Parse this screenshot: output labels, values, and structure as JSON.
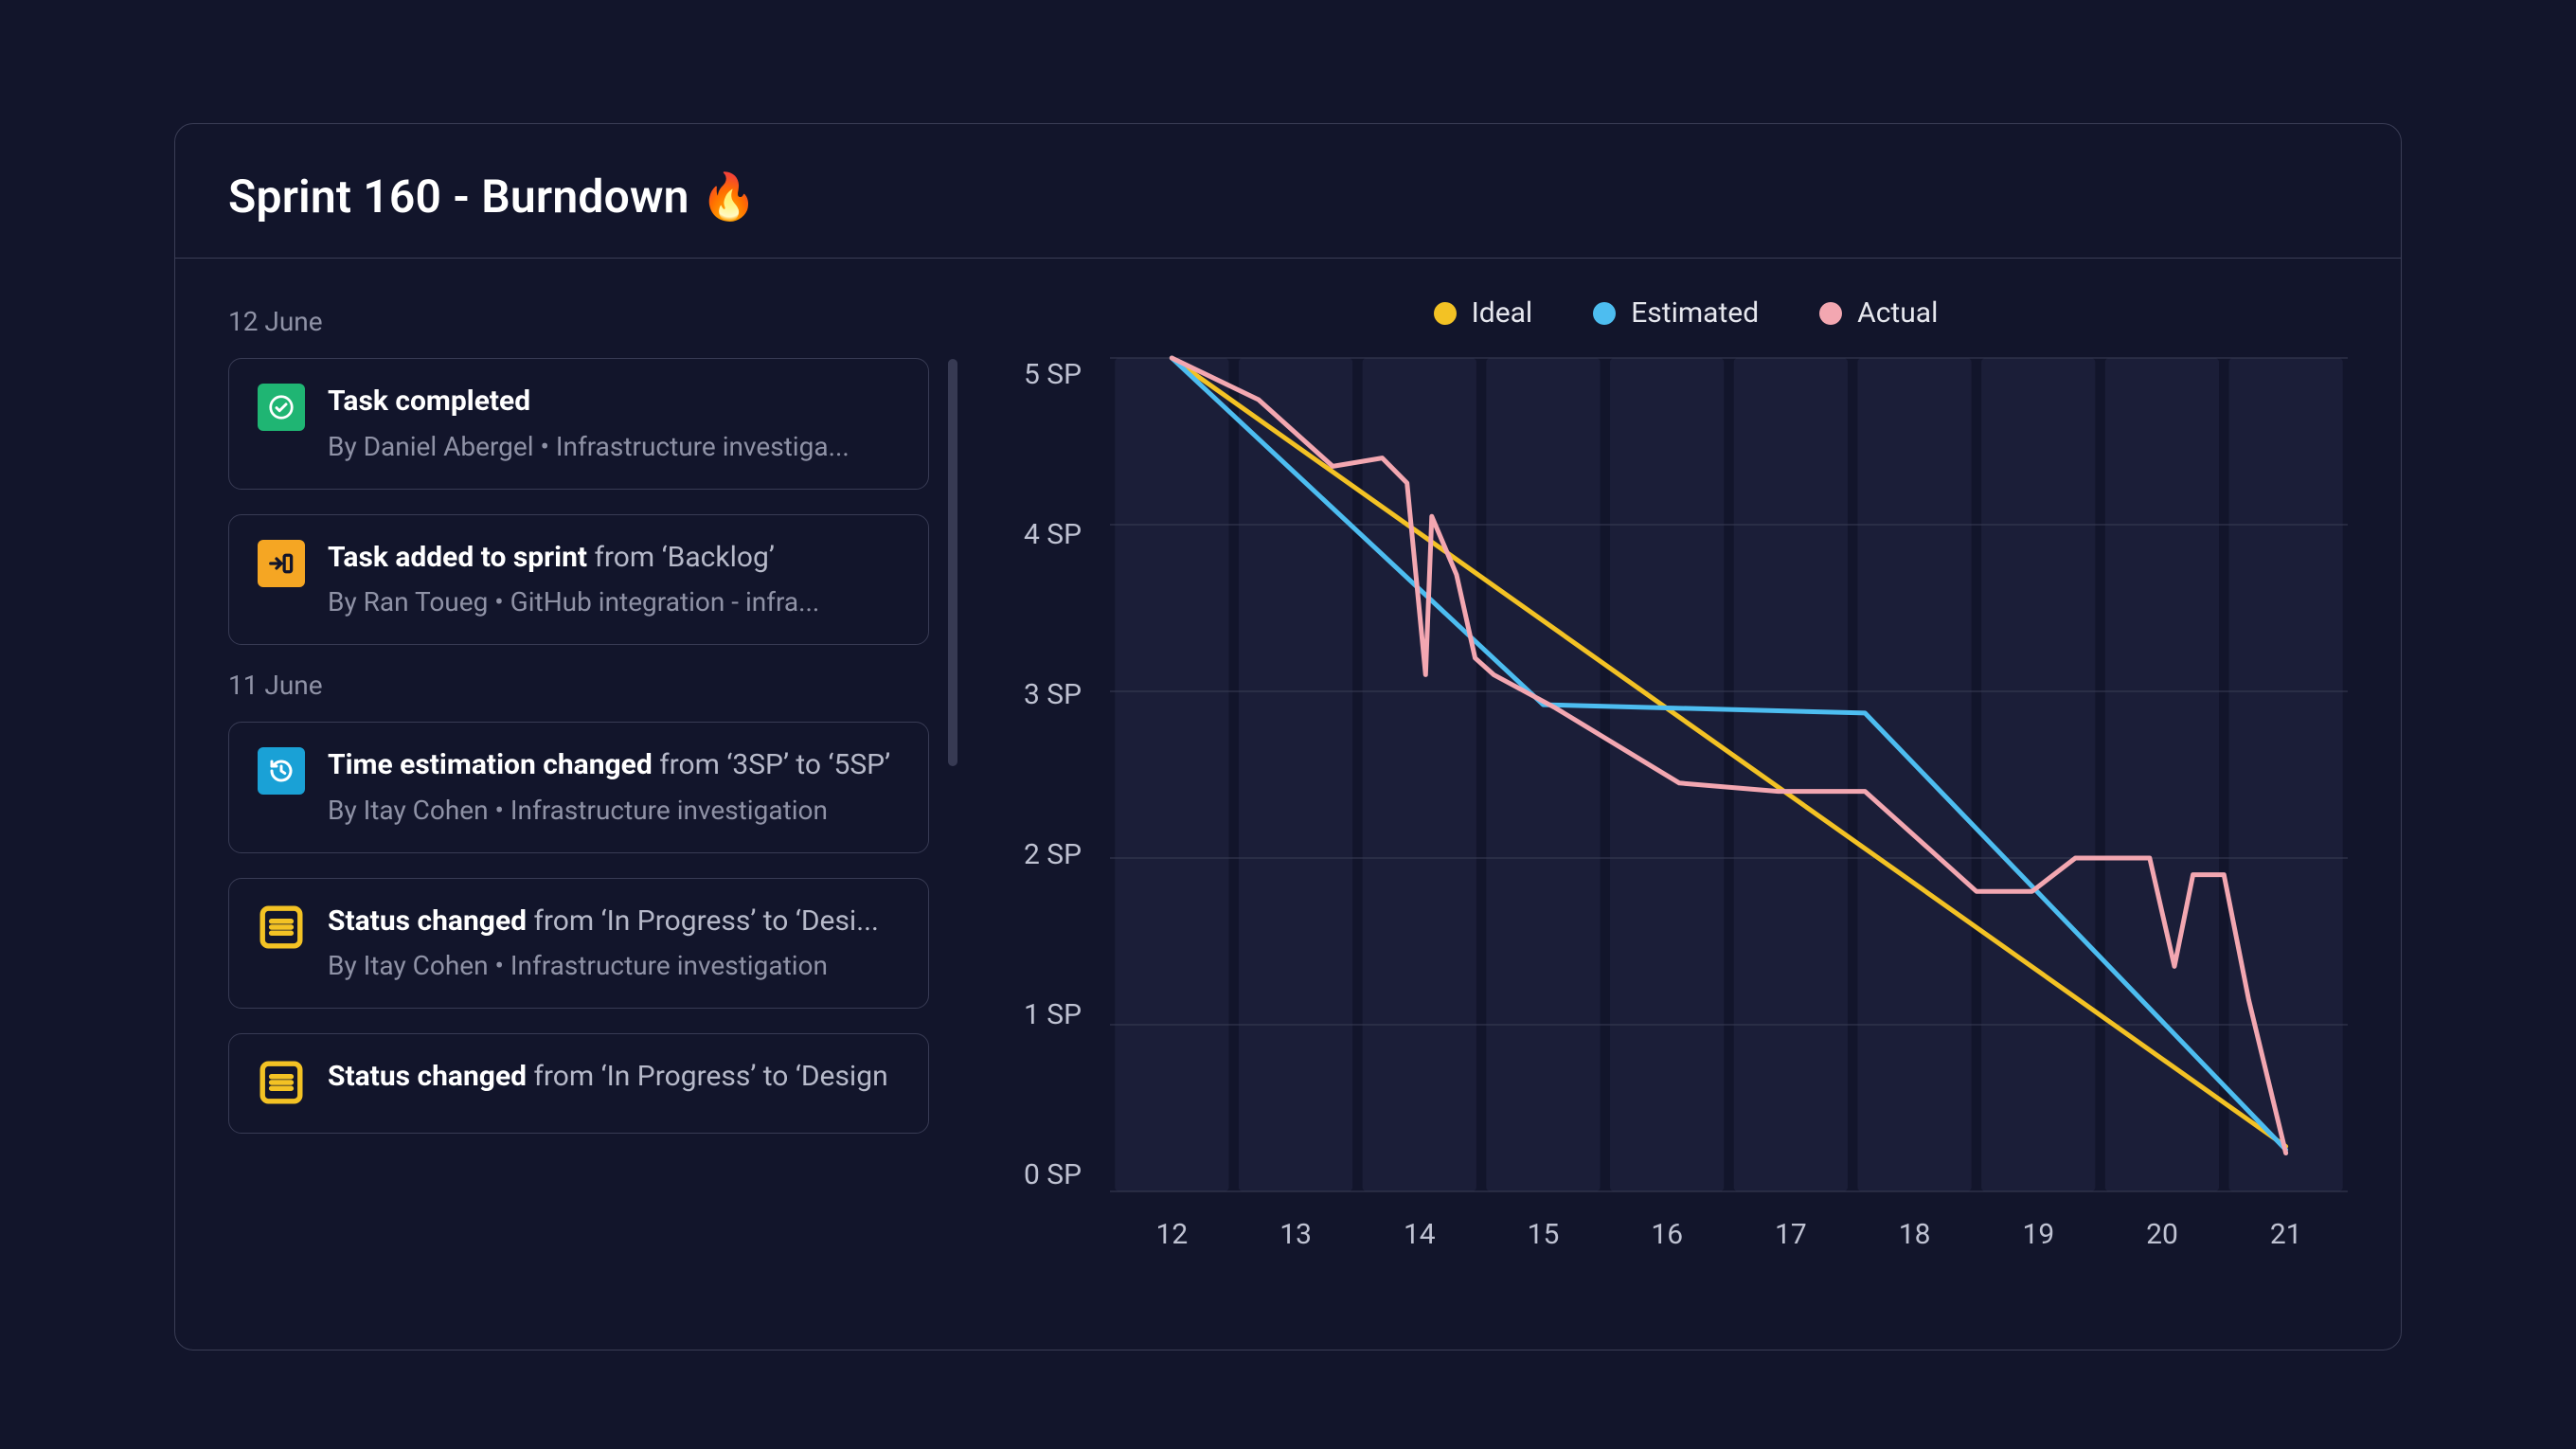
{
  "header": {
    "title": "Sprint 160 - Burndown 🔥"
  },
  "feed": {
    "groups": [
      {
        "date": "12 June",
        "items": [
          {
            "icon": "check-circle-icon",
            "icon_color": "green",
            "title_bold": "Task completed",
            "title_rest": "",
            "byline": "By Daniel Abergel • Infrastructure investiga..."
          },
          {
            "icon": "add-to-sprint-icon",
            "icon_color": "orange",
            "title_bold": "Task added to sprint",
            "title_rest": " from ‘Backlog’",
            "byline": "By Ran Toueg • GitHub integration - infra..."
          }
        ]
      },
      {
        "date": "11 June",
        "items": [
          {
            "icon": "history-icon",
            "icon_color": "blue",
            "title_bold": "Time estimation changed",
            "title_rest": " from ‘3SP’ to ‘5SP’",
            "byline": "By Itay Cohen • Infrastructure investigation"
          },
          {
            "icon": "status-icon",
            "icon_color": "yellow",
            "title_bold": "Status changed",
            "title_rest": " from ‘In Progress’ to ‘Desi...",
            "byline": "By Itay Cohen • Infrastructure investigation"
          },
          {
            "icon": "status-icon",
            "icon_color": "yellow",
            "title_bold": "Status changed",
            "title_rest": " from ‘In Progress’ to ‘Design",
            "byline": ""
          }
        ]
      }
    ]
  },
  "legend": {
    "items": [
      {
        "label": "Ideal",
        "color": "#f3c224"
      },
      {
        "label": "Estimated",
        "color": "#4dbdf0"
      },
      {
        "label": "Actual",
        "color": "#f3a7b1"
      }
    ]
  },
  "chart_data": {
    "type": "line",
    "title": "Sprint 160 - Burndown",
    "xlabel": "",
    "ylabel": "SP",
    "ylim": [
      0,
      5
    ],
    "y_ticks": [
      "5 SP",
      "4 SP",
      "3 SP",
      "2 SP",
      "1 SP",
      "0 SP"
    ],
    "x_ticks": [
      "12",
      "13",
      "14",
      "15",
      "16",
      "17",
      "18",
      "19",
      "20",
      "21"
    ],
    "series": [
      {
        "name": "Ideal",
        "color": "#f3c224",
        "points": [
          [
            12,
            5.0
          ],
          [
            21,
            0.27
          ]
        ]
      },
      {
        "name": "Estimated",
        "color": "#4dbdf0",
        "points": [
          [
            12,
            5.0
          ],
          [
            15,
            2.92
          ],
          [
            17.6,
            2.87
          ],
          [
            21,
            0.25
          ]
        ]
      },
      {
        "name": "Actual",
        "color": "#f3a7b1",
        "points": [
          [
            12,
            5.0
          ],
          [
            12.7,
            4.75
          ],
          [
            13.3,
            4.35
          ],
          [
            13.7,
            4.4
          ],
          [
            13.9,
            4.25
          ],
          [
            14.05,
            3.1
          ],
          [
            14.1,
            4.05
          ],
          [
            14.3,
            3.7
          ],
          [
            14.45,
            3.2
          ],
          [
            14.6,
            3.1
          ],
          [
            15.1,
            2.9
          ],
          [
            16.1,
            2.45
          ],
          [
            16.9,
            2.4
          ],
          [
            17.6,
            2.4
          ],
          [
            18.5,
            1.8
          ],
          [
            18.95,
            1.8
          ],
          [
            19.3,
            2.0
          ],
          [
            19.9,
            2.0
          ],
          [
            20.1,
            1.35
          ],
          [
            20.25,
            1.9
          ],
          [
            20.5,
            1.9
          ],
          [
            20.7,
            1.15
          ],
          [
            21,
            0.23
          ]
        ]
      }
    ]
  }
}
